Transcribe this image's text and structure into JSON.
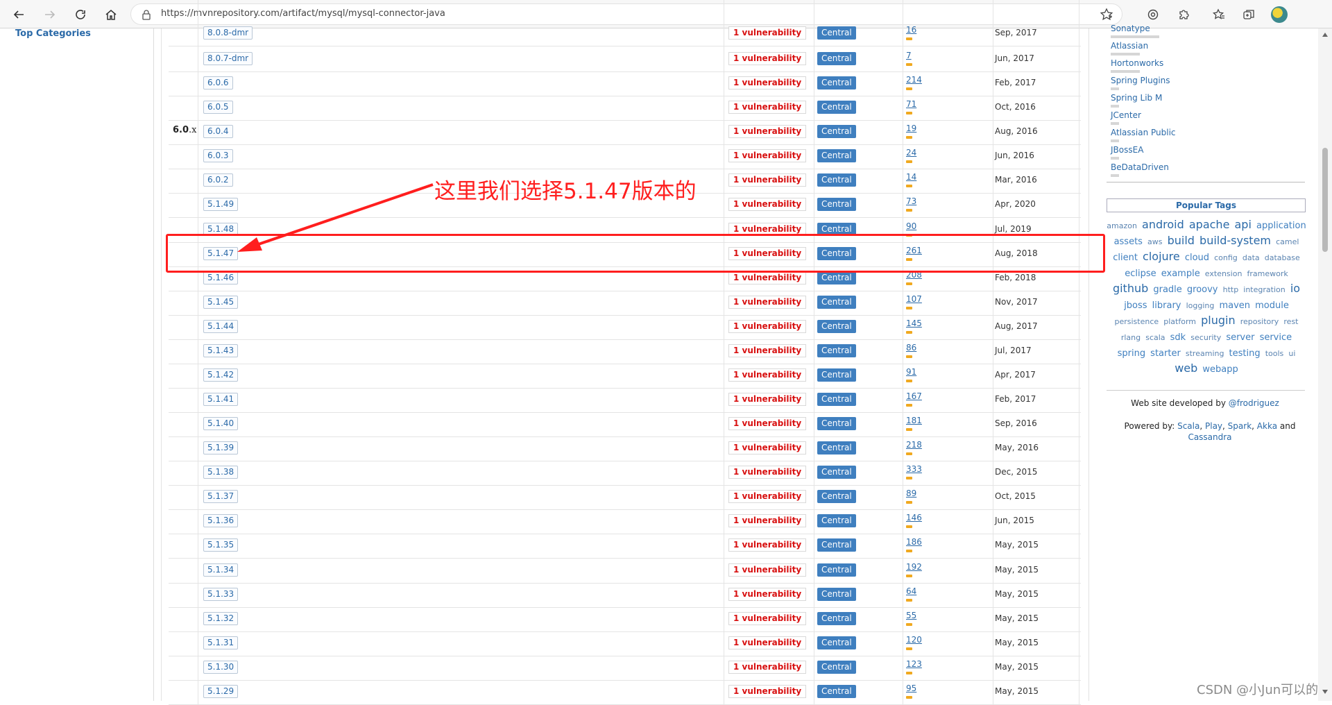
{
  "browser": {
    "url": "https://mvnrepository.com/artifact/mysql/mysql-connector-java"
  },
  "left_nav": {
    "top_categories": "Top Categories"
  },
  "groups": [
    {
      "major": "6.0",
      "suffix": ".x"
    }
  ],
  "versions": [
    {
      "version": "8.0.8-dmr",
      "vulnerability": "1 vulnerability",
      "repository": "Central",
      "usages": "16",
      "date": "Sep, 2017"
    },
    {
      "version": "8.0.7-dmr",
      "vulnerability": "1 vulnerability",
      "repository": "Central",
      "usages": "7",
      "date": "Jun, 2017"
    },
    {
      "version": "6.0.6",
      "vulnerability": "1 vulnerability",
      "repository": "Central",
      "usages": "214",
      "date": "Feb, 2017"
    },
    {
      "version": "6.0.5",
      "vulnerability": "1 vulnerability",
      "repository": "Central",
      "usages": "71",
      "date": "Oct, 2016"
    },
    {
      "version": "6.0.4",
      "vulnerability": "1 vulnerability",
      "repository": "Central",
      "usages": "19",
      "date": "Aug, 2016"
    },
    {
      "version": "6.0.3",
      "vulnerability": "1 vulnerability",
      "repository": "Central",
      "usages": "24",
      "date": "Jun, 2016"
    },
    {
      "version": "6.0.2",
      "vulnerability": "1 vulnerability",
      "repository": "Central",
      "usages": "14",
      "date": "Mar, 2016"
    },
    {
      "version": "5.1.49",
      "vulnerability": "1 vulnerability",
      "repository": "Central",
      "usages": "73",
      "date": "Apr, 2020"
    },
    {
      "version": "5.1.48",
      "vulnerability": "1 vulnerability",
      "repository": "Central",
      "usages": "90",
      "date": "Jul, 2019"
    },
    {
      "version": "5.1.47",
      "vulnerability": "1 vulnerability",
      "repository": "Central",
      "usages": "261",
      "date": "Aug, 2018"
    },
    {
      "version": "5.1.46",
      "vulnerability": "1 vulnerability",
      "repository": "Central",
      "usages": "208",
      "date": "Feb, 2018"
    },
    {
      "version": "5.1.45",
      "vulnerability": "1 vulnerability",
      "repository": "Central",
      "usages": "107",
      "date": "Nov, 2017"
    },
    {
      "version": "5.1.44",
      "vulnerability": "1 vulnerability",
      "repository": "Central",
      "usages": "145",
      "date": "Aug, 2017"
    },
    {
      "version": "5.1.43",
      "vulnerability": "1 vulnerability",
      "repository": "Central",
      "usages": "86",
      "date": "Jul, 2017"
    },
    {
      "version": "5.1.42",
      "vulnerability": "1 vulnerability",
      "repository": "Central",
      "usages": "91",
      "date": "Apr, 2017"
    },
    {
      "version": "5.1.41",
      "vulnerability": "1 vulnerability",
      "repository": "Central",
      "usages": "167",
      "date": "Feb, 2017"
    },
    {
      "version": "5.1.40",
      "vulnerability": "1 vulnerability",
      "repository": "Central",
      "usages": "181",
      "date": "Sep, 2016"
    },
    {
      "version": "5.1.39",
      "vulnerability": "1 vulnerability",
      "repository": "Central",
      "usages": "218",
      "date": "May, 2016"
    },
    {
      "version": "5.1.38",
      "vulnerability": "1 vulnerability",
      "repository": "Central",
      "usages": "333",
      "date": "Dec, 2015"
    },
    {
      "version": "5.1.37",
      "vulnerability": "1 vulnerability",
      "repository": "Central",
      "usages": "89",
      "date": "Oct, 2015"
    },
    {
      "version": "5.1.36",
      "vulnerability": "1 vulnerability",
      "repository": "Central",
      "usages": "146",
      "date": "Jun, 2015"
    },
    {
      "version": "5.1.35",
      "vulnerability": "1 vulnerability",
      "repository": "Central",
      "usages": "186",
      "date": "May, 2015"
    },
    {
      "version": "5.1.34",
      "vulnerability": "1 vulnerability",
      "repository": "Central",
      "usages": "192",
      "date": "May, 2015"
    },
    {
      "version": "5.1.33",
      "vulnerability": "1 vulnerability",
      "repository": "Central",
      "usages": "64",
      "date": "May, 2015"
    },
    {
      "version": "5.1.32",
      "vulnerability": "1 vulnerability",
      "repository": "Central",
      "usages": "55",
      "date": "May, 2015"
    },
    {
      "version": "5.1.31",
      "vulnerability": "1 vulnerability",
      "repository": "Central",
      "usages": "120",
      "date": "May, 2015"
    },
    {
      "version": "5.1.30",
      "vulnerability": "1 vulnerability",
      "repository": "Central",
      "usages": "123",
      "date": "May, 2015"
    },
    {
      "version": "5.1.29",
      "vulnerability": "1 vulnerability",
      "repository": "Central",
      "usages": "95",
      "date": "May, 2015"
    }
  ],
  "annotation": {
    "text": "这里我们选择5.1.47版本的",
    "color": "#ff1e1e"
  },
  "sidebar": {
    "repositories": [
      "Sonatype",
      "Atlassian",
      "Hortonworks",
      "Spring Plugins",
      "Spring Lib M",
      "JCenter",
      "Atlassian Public",
      "JBossEA",
      "BeDataDriven"
    ],
    "popular_tags_title": "Popular Tags",
    "tags": [
      {
        "t": "amazon",
        "s": 1
      },
      {
        "t": "android",
        "s": 3
      },
      {
        "t": "apache",
        "s": 3
      },
      {
        "t": "api",
        "s": 3
      },
      {
        "t": "application",
        "s": 2
      },
      {
        "t": "assets",
        "s": 2
      },
      {
        "t": "aws",
        "s": 1
      },
      {
        "t": "build",
        "s": 3
      },
      {
        "t": "build-system",
        "s": 3
      },
      {
        "t": "camel",
        "s": 1
      },
      {
        "t": "client",
        "s": 2
      },
      {
        "t": "clojure",
        "s": 3
      },
      {
        "t": "cloud",
        "s": 2
      },
      {
        "t": "config",
        "s": 1
      },
      {
        "t": "data",
        "s": 1
      },
      {
        "t": "database",
        "s": 1
      },
      {
        "t": "eclipse",
        "s": 2
      },
      {
        "t": "example",
        "s": 2
      },
      {
        "t": "extension",
        "s": 1
      },
      {
        "t": "framework",
        "s": 1
      },
      {
        "t": "github",
        "s": 3
      },
      {
        "t": "gradle",
        "s": 2
      },
      {
        "t": "groovy",
        "s": 2
      },
      {
        "t": "http",
        "s": 1
      },
      {
        "t": "integration",
        "s": 1
      },
      {
        "t": "io",
        "s": 3
      },
      {
        "t": "jboss",
        "s": 2
      },
      {
        "t": "library",
        "s": 2
      },
      {
        "t": "logging",
        "s": 1
      },
      {
        "t": "maven",
        "s": 2
      },
      {
        "t": "module",
        "s": 2
      },
      {
        "t": "persistence",
        "s": 1
      },
      {
        "t": "platform",
        "s": 1
      },
      {
        "t": "plugin",
        "s": 3
      },
      {
        "t": "repository",
        "s": 1
      },
      {
        "t": "rest",
        "s": 1
      },
      {
        "t": "rlang",
        "s": 1
      },
      {
        "t": "scala",
        "s": 1
      },
      {
        "t": "sdk",
        "s": 2
      },
      {
        "t": "security",
        "s": 1
      },
      {
        "t": "server",
        "s": 2
      },
      {
        "t": "service",
        "s": 2
      },
      {
        "t": "spring",
        "s": 2
      },
      {
        "t": "starter",
        "s": 2
      },
      {
        "t": "streaming",
        "s": 1
      },
      {
        "t": "testing",
        "s": 2
      },
      {
        "t": "tools",
        "s": 1
      },
      {
        "t": "ui",
        "s": 1
      },
      {
        "t": "web",
        "s": 3
      },
      {
        "t": "webapp",
        "s": 2
      }
    ],
    "developed_by_label": "Web site developed by",
    "developer": "@frodriguez",
    "powered_label": "Powered by:",
    "powered": [
      "Scala",
      "Play",
      "Spark",
      "Akka",
      "Cassandra"
    ],
    "and_word": "and"
  },
  "watermark": "CSDN @小Jun可以的"
}
